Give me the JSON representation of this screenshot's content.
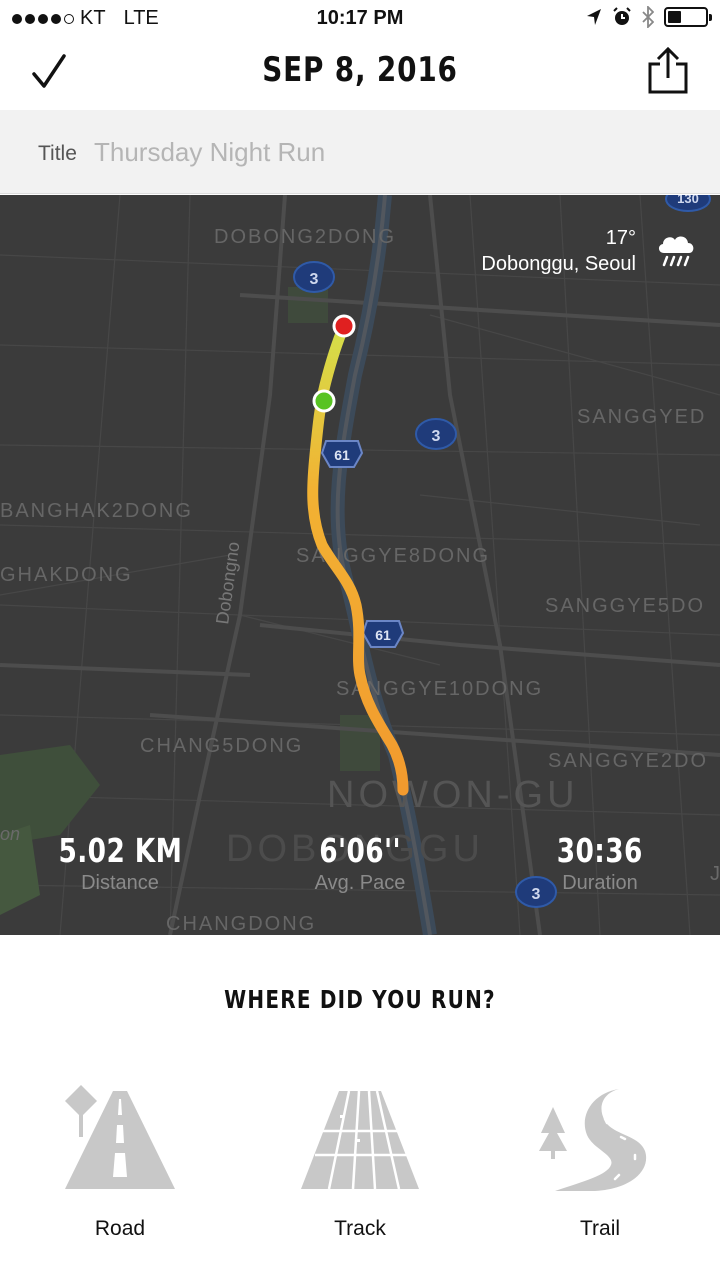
{
  "status_bar": {
    "carrier": "KT",
    "network": "LTE",
    "time": "10:17 PM",
    "battery_level": 0.35
  },
  "header": {
    "title": "SEP 8, 2016",
    "confirm_icon": "checkmark-icon",
    "share_icon": "share-icon"
  },
  "title_field": {
    "label": "Title",
    "placeholder": "Thursday Night Run"
  },
  "map": {
    "weather": {
      "temperature": "17°",
      "location": "Dobonggu, Seoul",
      "icon": "rain-cloud-icon"
    },
    "labels": {
      "dobong2dong": "DOBONG2DONG",
      "sanggyed": "SANGGYED",
      "banghak2dong": "BANGHAK2DONG",
      "ghakdong": "GHAKDONG",
      "dobongno": "Dobongno",
      "sanggye8dong": "SANGGYE8DONG",
      "sanggye5do": "SANGGYE5DO",
      "sanggye10dong": "SANGGYE10DONG",
      "chang5dong": "CHANG5DONG",
      "sanggye2do": "SANGGYE2DO",
      "nowongu": "NOWON-GU",
      "dobonggu": "DOBONGGU",
      "changdong": "CHANGDONG",
      "on": "on",
      "j": "J",
      "route3": "3",
      "route61": "61",
      "route130": "130"
    },
    "route_colors": {
      "start": "#d4e04a",
      "mid": "#f2b233",
      "end": "#f29a2e"
    },
    "start_color": "#58c322",
    "end_color": "#e02020"
  },
  "stats": {
    "distance": {
      "value": "5.02 KM",
      "label": "Distance"
    },
    "pace": {
      "value": "6'06''",
      "label": "Avg. Pace"
    },
    "duration": {
      "value": "30:36",
      "label": "Duration"
    }
  },
  "surface_picker": {
    "question": "WHERE DID YOU RUN?",
    "options": [
      {
        "label": "Road",
        "icon": "road-icon"
      },
      {
        "label": "Track",
        "icon": "track-icon"
      },
      {
        "label": "Trail",
        "icon": "trail-icon"
      }
    ]
  }
}
